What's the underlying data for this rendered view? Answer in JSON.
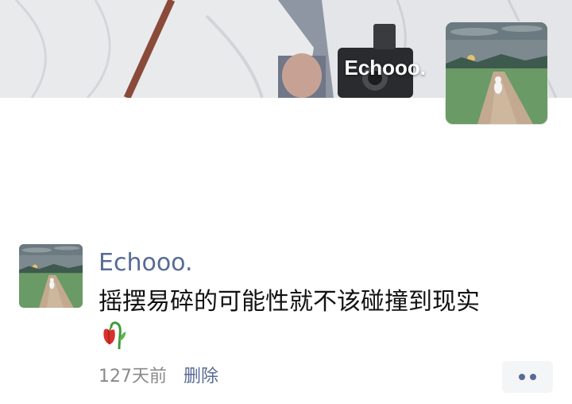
{
  "cover": {
    "display_name": "Echooo."
  },
  "post": {
    "author": "Echooo.",
    "content": "摇摆易碎的可能性就不该碰撞到现实",
    "emoji": "wilted-flower-emoji",
    "time_ago": "127天前",
    "delete_label": "删除"
  },
  "icons": {
    "more": "more-dots-icon"
  },
  "colors": {
    "link": "#576b95",
    "meta": "#8a8a8a",
    "text": "#111111",
    "more_bg": "#f4f5f7"
  }
}
